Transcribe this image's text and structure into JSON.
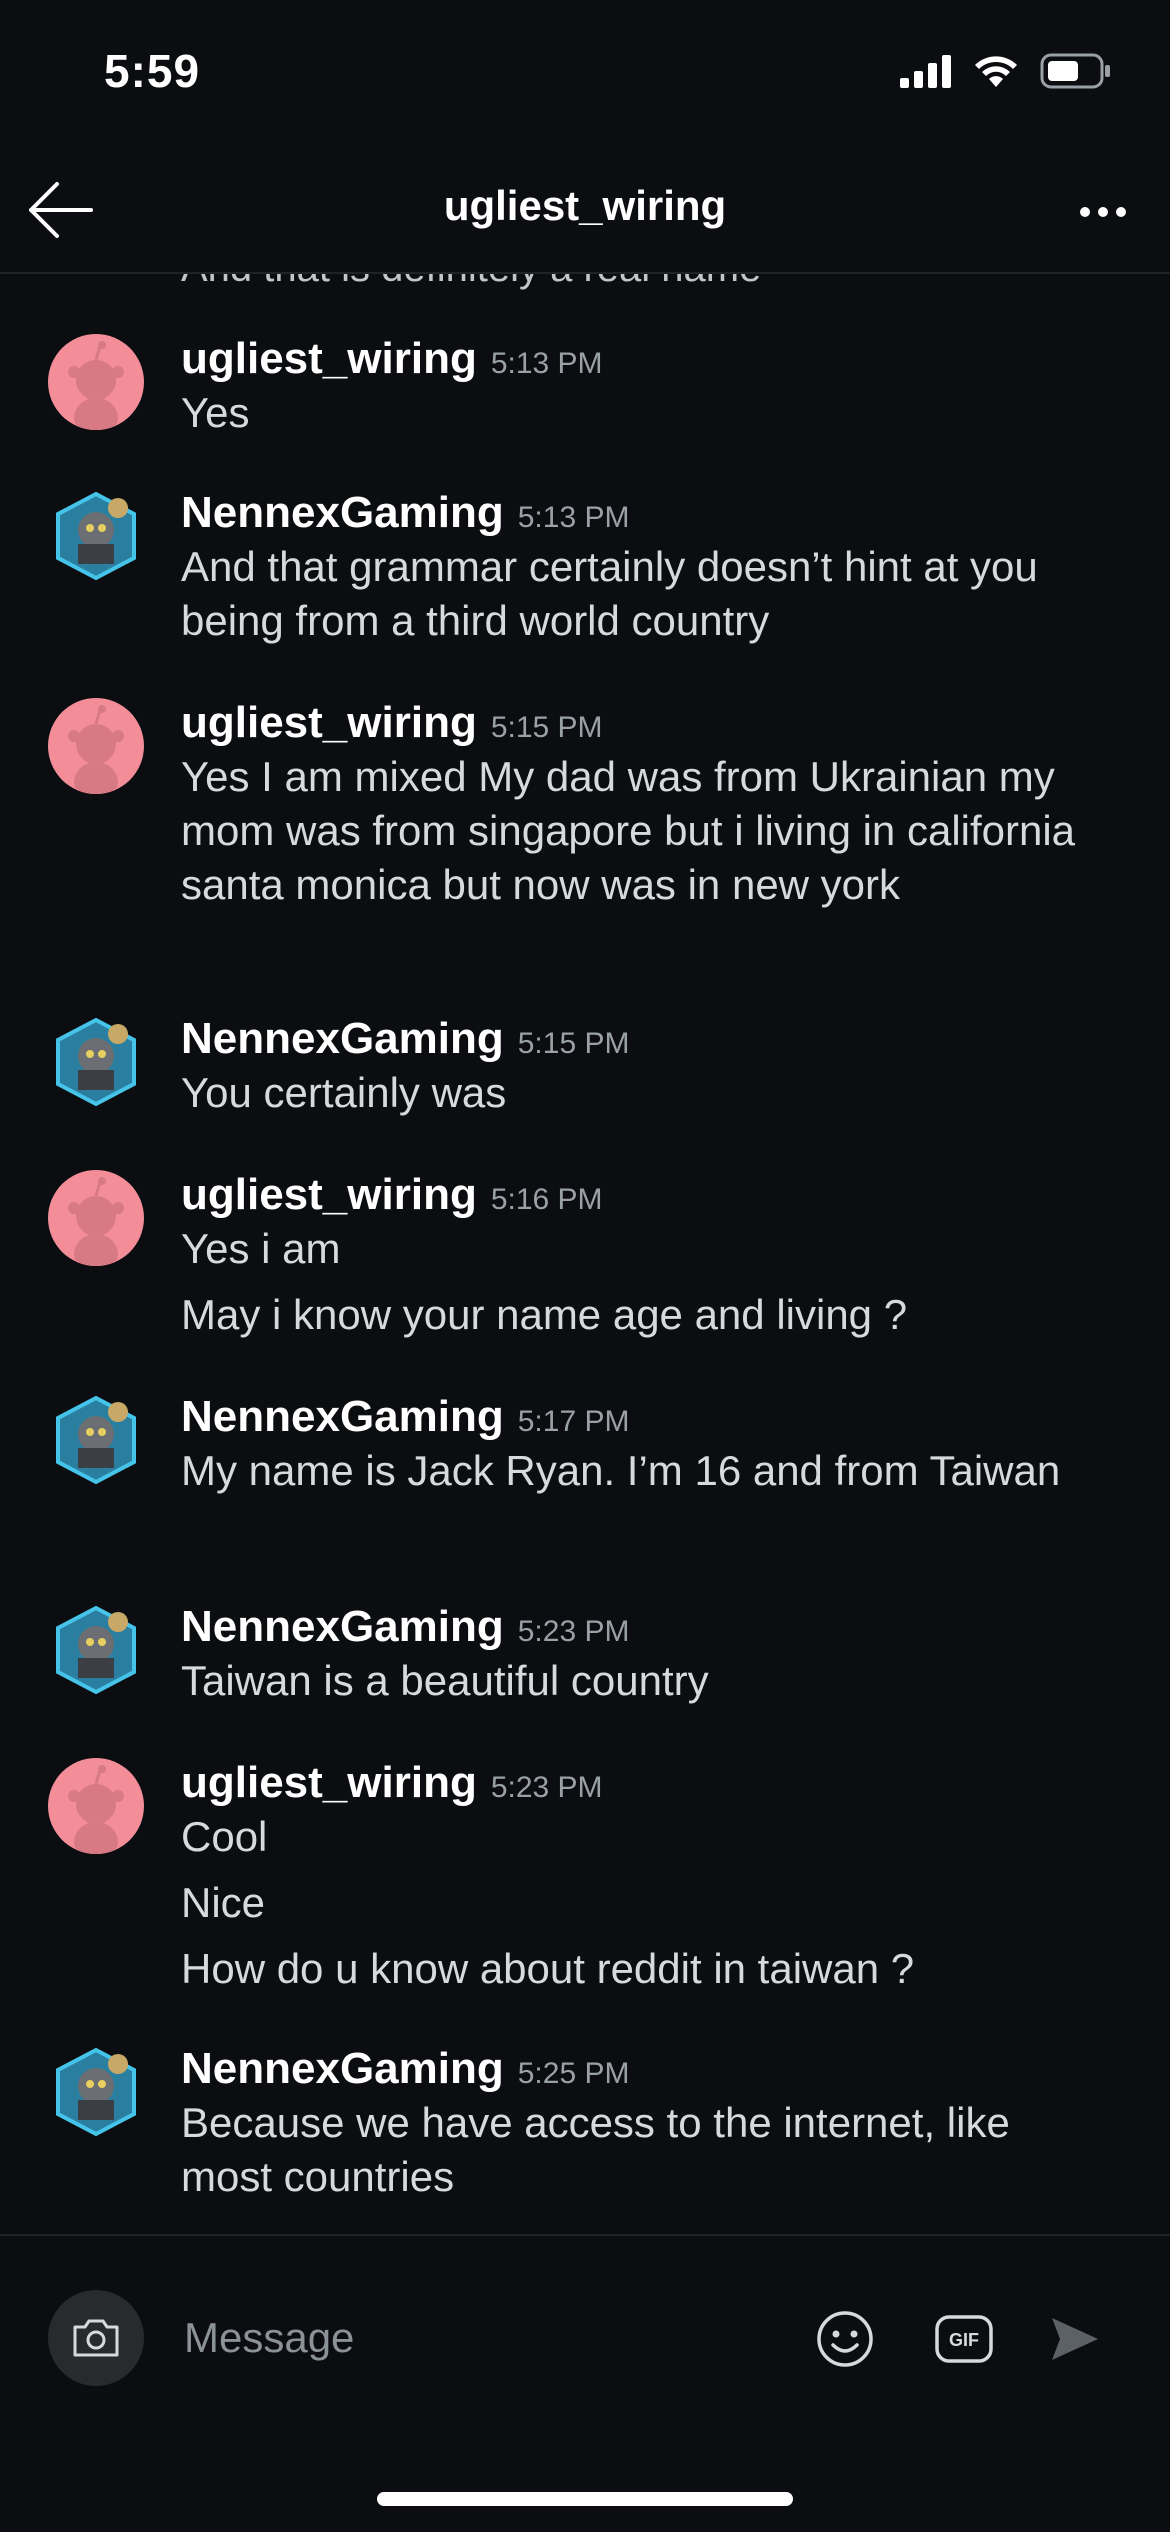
{
  "status_bar": {
    "time": "5:59"
  },
  "header": {
    "title": "ugliest_wiring"
  },
  "partial_message": "And that is definitely a real name",
  "messages": [
    {
      "author": "ugliest_wiring",
      "time": "5:13 PM",
      "lines": [
        "Yes"
      ]
    },
    {
      "author": "NennexGaming",
      "time": "5:13 PM",
      "lines": [
        "And that grammar certainly doesn’t hint at you being from a third world country"
      ]
    },
    {
      "author": "ugliest_wiring",
      "time": "5:15 PM",
      "lines": [
        "Yes I am mixed My dad was from Ukrainian my mom was from singapore but i living in california santa monica but now was in new york"
      ]
    },
    {
      "author": "NennexGaming",
      "time": "5:15 PM",
      "lines": [
        "You certainly was"
      ]
    },
    {
      "author": "ugliest_wiring",
      "time": "5:16 PM",
      "lines": [
        "Yes i am",
        "May i know your name age and living ?"
      ]
    },
    {
      "author": "NennexGaming",
      "time": "5:17 PM",
      "lines": [
        "My name is Jack Ryan. I’m 16 and from Taiwan"
      ]
    },
    {
      "author": "NennexGaming",
      "time": "5:23 PM",
      "lines": [
        "Taiwan is a beautiful country"
      ]
    },
    {
      "author": "ugliest_wiring",
      "time": "5:23 PM",
      "lines": [
        "Cool",
        "Nice",
        "How do u know about reddit in taiwan ?"
      ]
    },
    {
      "author": "NennexGaming",
      "time": "5:25 PM",
      "lines": [
        "Because we have access to the internet, like most countries"
      ]
    }
  ],
  "composer": {
    "placeholder": "Message",
    "gif_label": "GIF"
  },
  "colors": {
    "background": "#0b0d10",
    "snoo_avatar": "#f38e99",
    "text": "#d7dadc",
    "muted": "#9aa1a6"
  },
  "icons": [
    "back-arrow-icon",
    "more-icon",
    "signal-icon",
    "wifi-icon",
    "battery-icon",
    "camera-icon",
    "emoji-icon",
    "gif-icon",
    "send-icon"
  ]
}
